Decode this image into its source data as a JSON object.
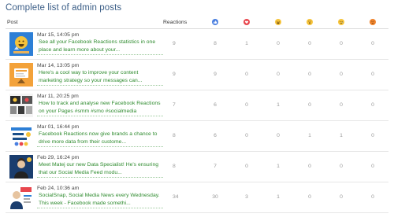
{
  "page": {
    "title": "Complete list of admin posts"
  },
  "table": {
    "columns": {
      "post": "Post",
      "reactions": "Reactions"
    },
    "reaction_icons": [
      {
        "name": "like-icon",
        "color": "#4a7fe0"
      },
      {
        "name": "love-icon",
        "color": "#e8474e"
      },
      {
        "name": "haha-icon",
        "color": "#f6c33a"
      },
      {
        "name": "wow-icon",
        "color": "#f6c33a"
      },
      {
        "name": "sad-icon",
        "color": "#f6c33a"
      },
      {
        "name": "angry-icon",
        "color": "#f0822a"
      }
    ],
    "rows": [
      {
        "date": "Mar 15, 14:05 pm",
        "text": "See all your Facebook Reactions statistics in one place and learn more about your...",
        "thumb": "reactions-stats-thumbnail",
        "values": [
          "9",
          "8",
          "1",
          "0",
          "0",
          "0",
          "0"
        ]
      },
      {
        "date": "Mar 14, 13:05 pm",
        "text": "Here's a cool way to improve your content marketing strategy so your messages can...",
        "thumb": "content-strategy-thumbnail",
        "values": [
          "9",
          "9",
          "0",
          "0",
          "0",
          "0",
          "0"
        ]
      },
      {
        "date": "Mar 11, 20:25 pm",
        "text": "How to track and analyse new Facebook Reactions on your Pages #smm #smo #socialmedia",
        "thumb": "track-reactions-thumbnail",
        "values": [
          "7",
          "6",
          "0",
          "1",
          "0",
          "0",
          "0"
        ]
      },
      {
        "date": "Mar 01, 16:44 pm",
        "text": "Facebook Reactions now give brands a chance to drive more data from their custome...",
        "thumb": "ask-reactions-thumbnail",
        "values": [
          "8",
          "6",
          "0",
          "0",
          "1",
          "1",
          "0"
        ]
      },
      {
        "date": "Feb 29, 16:24 pm",
        "text": "Meet Matej our new Data Specialist! He's ensuring that our Social Media Feed modu...",
        "thumb": "data-specialist-thumbnail",
        "values": [
          "8",
          "7",
          "0",
          "1",
          "0",
          "0",
          "0"
        ]
      },
      {
        "date": "Feb 24, 10:36 am",
        "text": "SocialSnap, Social Media News every Wednesday. This week - Facebook made somethi...",
        "thumb": "socialsnap-thumbnail",
        "values": [
          "34",
          "30",
          "3",
          "1",
          "0",
          "0",
          "0"
        ]
      }
    ]
  }
}
